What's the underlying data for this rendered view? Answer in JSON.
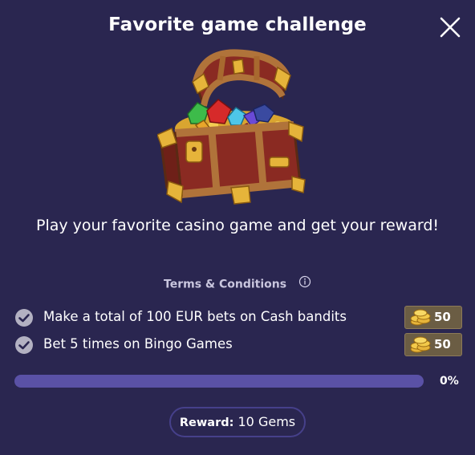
{
  "modal": {
    "title": "Favorite game challenge",
    "description": "Play your favorite casino game and get your reward!",
    "terms_label": "Terms & Conditions",
    "close_icon": "close-icon",
    "info_icon": "info-icon",
    "chest_image": "treasure-chest"
  },
  "tasks": [
    {
      "label": "Make a total of 100 EUR bets on Cash bandits",
      "reward": "50",
      "completed": true
    },
    {
      "label": "Bet 5 times on Bingo Games",
      "reward": "50",
      "completed": true
    }
  ],
  "progress": {
    "percent_label": "0%",
    "value": 0
  },
  "reward": {
    "label": "Reward:",
    "value": "10 Gems"
  },
  "colors": {
    "background": "#2a2650",
    "progress_track": "#5a51a6",
    "chip_background": "#6b5d44",
    "pill_border": "#46408a"
  }
}
